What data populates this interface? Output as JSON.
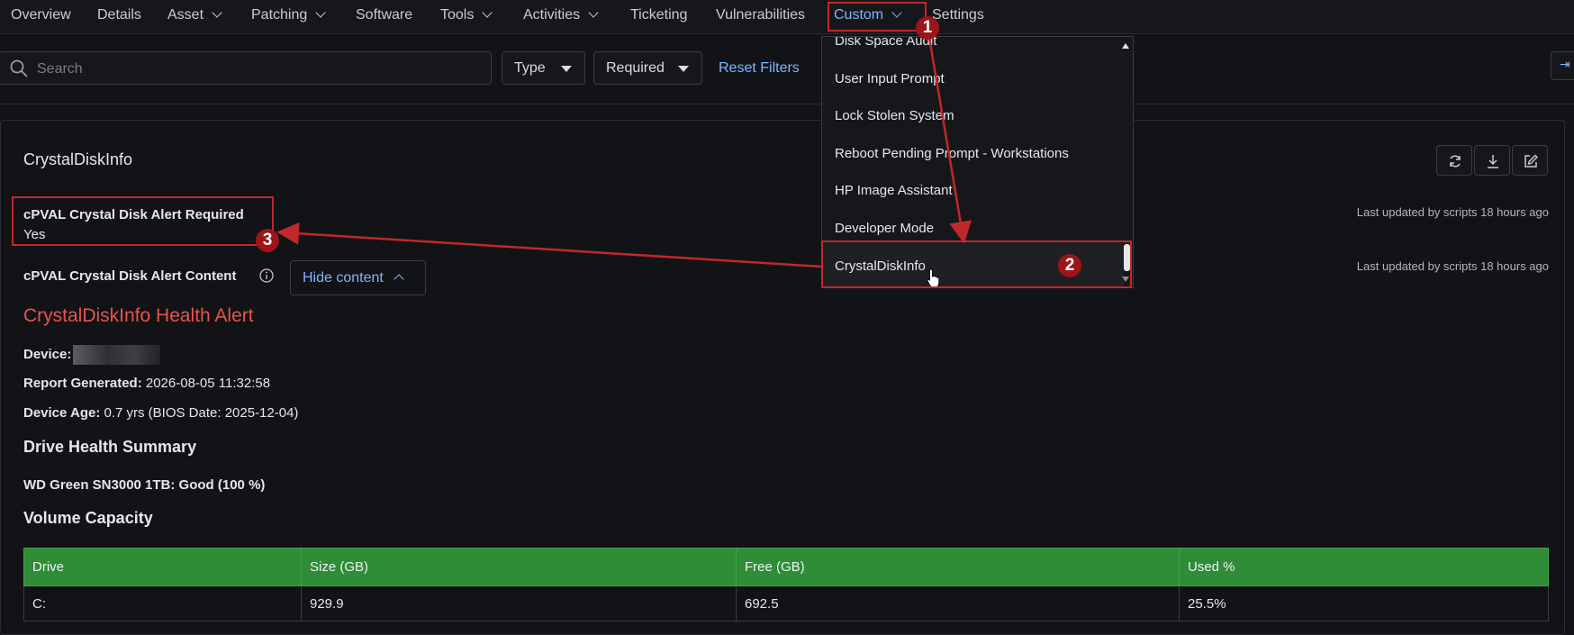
{
  "nav": {
    "items": [
      {
        "label": "Overview",
        "dropdown": false
      },
      {
        "label": "Details",
        "dropdown": false
      },
      {
        "label": "Asset",
        "dropdown": true
      },
      {
        "label": "Patching",
        "dropdown": true
      },
      {
        "label": "Software",
        "dropdown": false
      },
      {
        "label": "Tools",
        "dropdown": true
      },
      {
        "label": "Activities",
        "dropdown": true
      },
      {
        "label": "Ticketing",
        "dropdown": false
      },
      {
        "label": "Vulnerabilities",
        "dropdown": false
      },
      {
        "label": "Custom",
        "dropdown": true,
        "active": true
      },
      {
        "label": "Settings",
        "dropdown": false
      }
    ]
  },
  "filters": {
    "search_placeholder": "Search",
    "type_label": "Type",
    "required_label": "Required",
    "reset_label": "Reset Filters"
  },
  "menu": {
    "items": [
      "Disk Space Audit",
      "User Input Prompt",
      "Lock Stolen System",
      "Reboot Pending Prompt - Workstations",
      "HP Image Assistant",
      "Developer Mode",
      "CrystalDiskInfo"
    ],
    "selected": "CrystalDiskInfo"
  },
  "panel": {
    "title": "CrystalDiskInfo",
    "field1_label": "cPVAL Crystal Disk Alert Required",
    "field1_value": "Yes",
    "field1_updated": "Last updated by scripts 18 hours ago",
    "field2_label": "cPVAL Crystal Disk Alert Content",
    "field2_updated": "Last updated by scripts 18 hours ago",
    "hide_content_label": "Hide content"
  },
  "report": {
    "title": "CrystalDiskInfo Health Alert",
    "device_label": "Device:",
    "generated_label": "Report Generated:",
    "generated_value": "2026-08-05 11:32:58",
    "age_label": "Device Age:",
    "age_value": "0.7 yrs (BIOS Date: 2025-12-04)",
    "summary_heading": "Drive Health Summary",
    "drive_status": "WD Green SN3000 1TB: Good (100 %)",
    "volume_heading": "Volume Capacity",
    "table": {
      "headers": [
        "Drive",
        "Size (GB)",
        "Free (GB)",
        "Used %"
      ],
      "rows": [
        [
          "C:",
          "929.9",
          "692.5",
          "25.5%"
        ]
      ]
    }
  },
  "annotations": {
    "badge1": "1",
    "badge2": "2",
    "badge3": "3",
    "color": "#c0282c"
  },
  "colors": {
    "accent": "#7fb6ff",
    "alert_title": "#e8524c",
    "table_header": "#2f8c37",
    "background": "#121316"
  }
}
